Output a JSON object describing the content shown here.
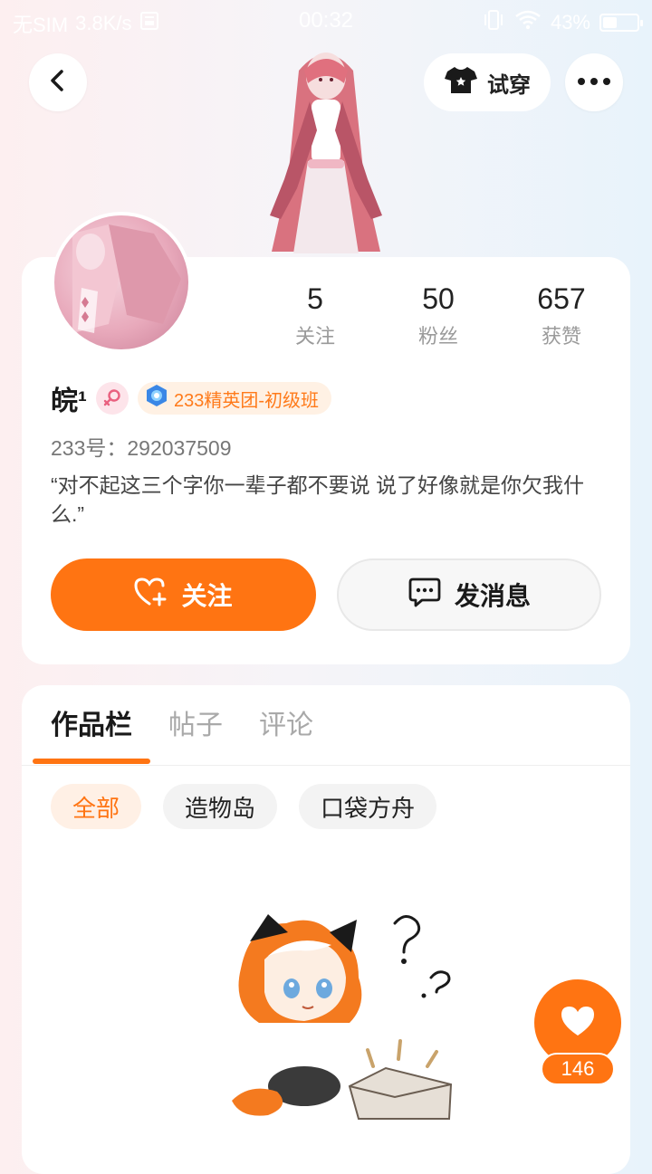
{
  "status_bar": {
    "carrier": "无SIM",
    "speed": "3.8K/s",
    "time": "00:32",
    "battery": "43%",
    "battery_level": 0.43
  },
  "header": {
    "tryon_label": "试穿"
  },
  "profile": {
    "stats": [
      {
        "value": "5",
        "label": "关注"
      },
      {
        "value": "50",
        "label": "粉丝"
      },
      {
        "value": "657",
        "label": "获赞"
      }
    ],
    "name": "皖¹",
    "badge": "233精英团-初级班",
    "uid": "233号：292037509",
    "bio": "“对不起这三个字你一辈子都不要说 说了好像就是你欠我什么.”",
    "follow_label": "关注",
    "message_label": "发消息"
  },
  "works": {
    "tabs": [
      "作品栏",
      "帖子",
      "评论"
    ],
    "filters": [
      "全部",
      "造物岛",
      "口袋方舟"
    ]
  },
  "like": {
    "count": "146"
  },
  "colors": {
    "accent": "#ff7412",
    "badge_bg": "#fff1e4"
  }
}
